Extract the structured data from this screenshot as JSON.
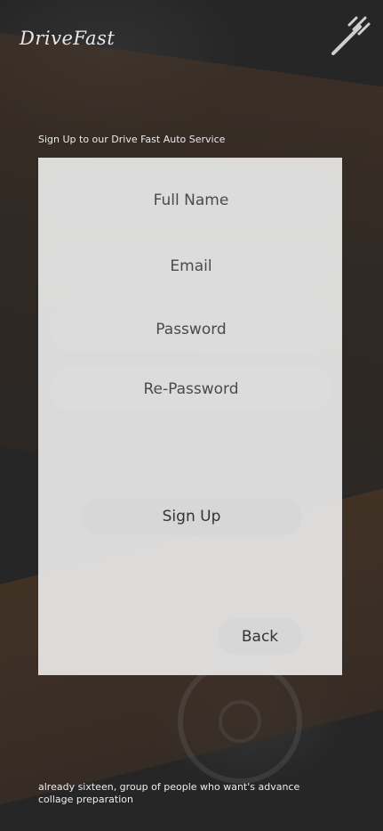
{
  "brand": {
    "logo_text": "DriveFast"
  },
  "header": {
    "menu_icon": "wrench-tools-icon"
  },
  "signup": {
    "subtitle": "Sign Up to our Drive Fast Auto Service",
    "fields": {
      "full_name_placeholder": "Full Name",
      "email_placeholder": "Email",
      "password_placeholder": "Password",
      "repassword_placeholder": "Re-Password"
    },
    "signup_label": "Sign Up",
    "back_label": "Back"
  },
  "footer": {
    "text": "already sixteen, group of people who want's advance collage preparation"
  },
  "colors": {
    "background": "#262626",
    "panel": "#e8e8e8",
    "field": "#dcdcdc",
    "accent_band": "#3a2e25"
  }
}
